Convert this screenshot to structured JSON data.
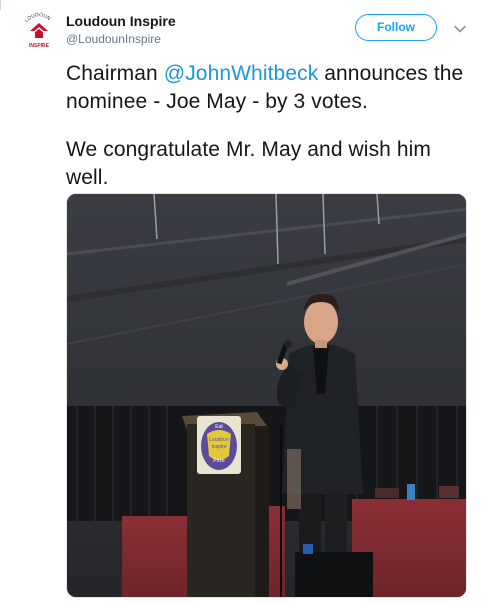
{
  "tweet": {
    "author": {
      "display_name": "Loudoun Inspire",
      "handle": "@LoudounInspire",
      "avatar_icon": "loudoun-inspire-logo",
      "avatar_text_top": "LOUDOUN",
      "avatar_text_bottom": "INSPIRE"
    },
    "follow_label": "Follow",
    "menu_icon": "chevron-down-icon",
    "text": {
      "line1_prefix": "Chairman ",
      "mention": "@JohnWhitbeck",
      "line1_suffix": " announces the nominee - Joe May - by 3 votes.",
      "paragraph2": "We congratulate Mr. May and wish him well."
    },
    "photo": {
      "description_icon": "photo-speaker-at-podium",
      "podium_sign_line1": "Eat",
      "podium_sign_line2": "Loudoun",
      "podium_sign_line3": "Inspire",
      "podium_sign_line4": "Prize"
    }
  },
  "colors": {
    "accent": "#1da1f2",
    "mention": "#1b95e0",
    "text": "#14171a",
    "secondary_text": "#657786",
    "logo_red": "#c8102e"
  }
}
